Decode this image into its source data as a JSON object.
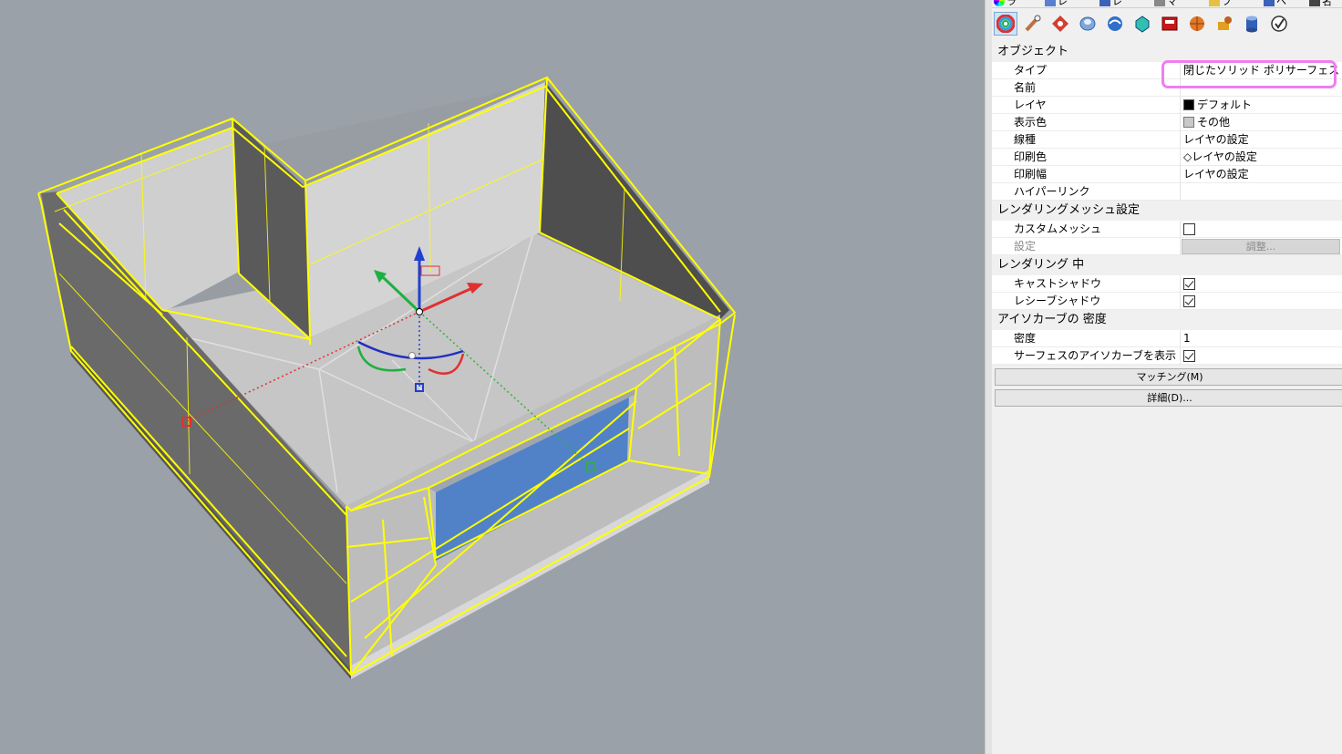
{
  "tabs": [
    {
      "label": "ラ",
      "icon": "color-wheel-icon"
    },
    {
      "label": "レ",
      "icon": "layer-icon"
    },
    {
      "label": "レ",
      "icon": "render-icon"
    },
    {
      "label": "マ",
      "icon": "material-icon"
    },
    {
      "label": "フ",
      "icon": "folder-icon"
    },
    {
      "label": "ヘ",
      "icon": "help-icon"
    },
    {
      "label": "名",
      "icon": "named-view-icon"
    }
  ],
  "toolbar_icons": [
    "object-properties-icon",
    "curve-piping-icon",
    "decal-icon",
    "displacement-icon",
    "edge-softening-icon",
    "shut-lining-icon",
    "texture-mapping-icon",
    "named-position-icon",
    "thickening-icon",
    "validate-icon"
  ],
  "sections": {
    "object": {
      "title": "オブジェクト",
      "rows": {
        "type": {
          "label": "タイプ",
          "value": "閉じたソリッド ポリサーフェス"
        },
        "name": {
          "label": "名前",
          "value": ""
        },
        "layer": {
          "label": "レイヤ",
          "value": "デフォルト",
          "swatch": "#000000"
        },
        "display": {
          "label": "表示色",
          "value": "その他",
          "swatch": "#c8c8c8"
        },
        "linetype": {
          "label": "線種",
          "value": "レイヤの設定"
        },
        "printcolor": {
          "label": "印刷色",
          "value": "◇レイヤの設定"
        },
        "printwidth": {
          "label": "印刷幅",
          "value": "レイヤの設定"
        },
        "hyperlink": {
          "label": "ハイパーリンク",
          "value": ""
        }
      }
    },
    "mesh": {
      "title": "レンダリングメッシュ設定",
      "rows": {
        "custom": {
          "label": "カスタムメッシュ",
          "checked": false
        },
        "settings": {
          "label": "設定",
          "button": "調整..."
        }
      }
    },
    "rendering": {
      "title": "レンダリング 中",
      "rows": {
        "cast": {
          "label": "キャストシャドウ",
          "checked": true
        },
        "receive": {
          "label": "レシーブシャドウ",
          "checked": true
        }
      }
    },
    "isocurve": {
      "title": "アイソカーブの 密度",
      "rows": {
        "density": {
          "label": "密度",
          "value": "1"
        },
        "show": {
          "label": "サーフェスのアイソカーブを表示",
          "checked": true
        }
      }
    }
  },
  "buttons": {
    "match": "マッチング(M)",
    "details": "詳細(D)..."
  },
  "colors": {
    "viewport_bg": "#9ba1a8",
    "selection": "#ffff00",
    "highlight": "#f07ef0",
    "window_face": "#5182c8"
  }
}
